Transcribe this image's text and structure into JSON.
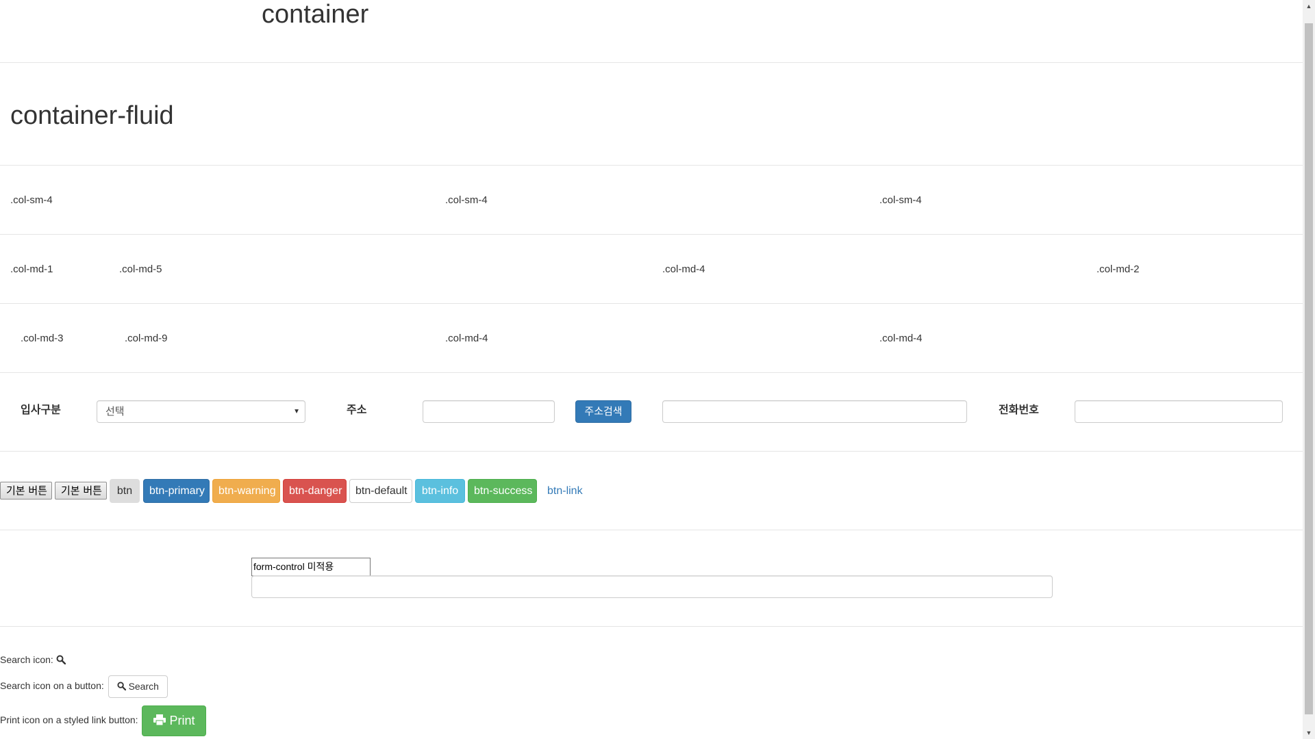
{
  "headers": {
    "container": "container",
    "container_fluid": "container-fluid"
  },
  "grid": {
    "row1": [
      ".col-sm-4",
      ".col-sm-4",
      ".col-sm-4"
    ],
    "row2": [
      ".col-md-1",
      ".col-md-5",
      ".col-md-4",
      ".col-md-2"
    ],
    "row3": [
      ".col-md-3",
      ".col-md-9",
      ".col-md-4",
      ".col-md-4"
    ]
  },
  "form": {
    "hire_type_label": "입사구분",
    "hire_type_selected": "선택",
    "address_label": "주소",
    "address_search_button": "주소검색",
    "phone_label": "전화번호"
  },
  "buttons": {
    "native_1": "기본 버튼",
    "native_2": "기본 버튼",
    "btn": "btn",
    "primary": "btn-primary",
    "warning": "btn-warning",
    "danger": "btn-danger",
    "default": "btn-default",
    "info": "btn-info",
    "success": "btn-success",
    "link": "btn-link"
  },
  "inputs": {
    "no_form_control_value": "form-control 미적용"
  },
  "icons": {
    "search_label": "Search icon:",
    "search_button_label": "Search icon on a button:",
    "search_button_text": "Search",
    "print_label": "Print icon on a styled link button:",
    "print_button_text": "Print",
    "search_icon": "search-icon",
    "print_icon": "print-icon"
  },
  "colors": {
    "primary": "#337ab7",
    "warning": "#f0ad4e",
    "danger": "#d9534f",
    "info": "#5bc0de",
    "success": "#5cb85c"
  }
}
